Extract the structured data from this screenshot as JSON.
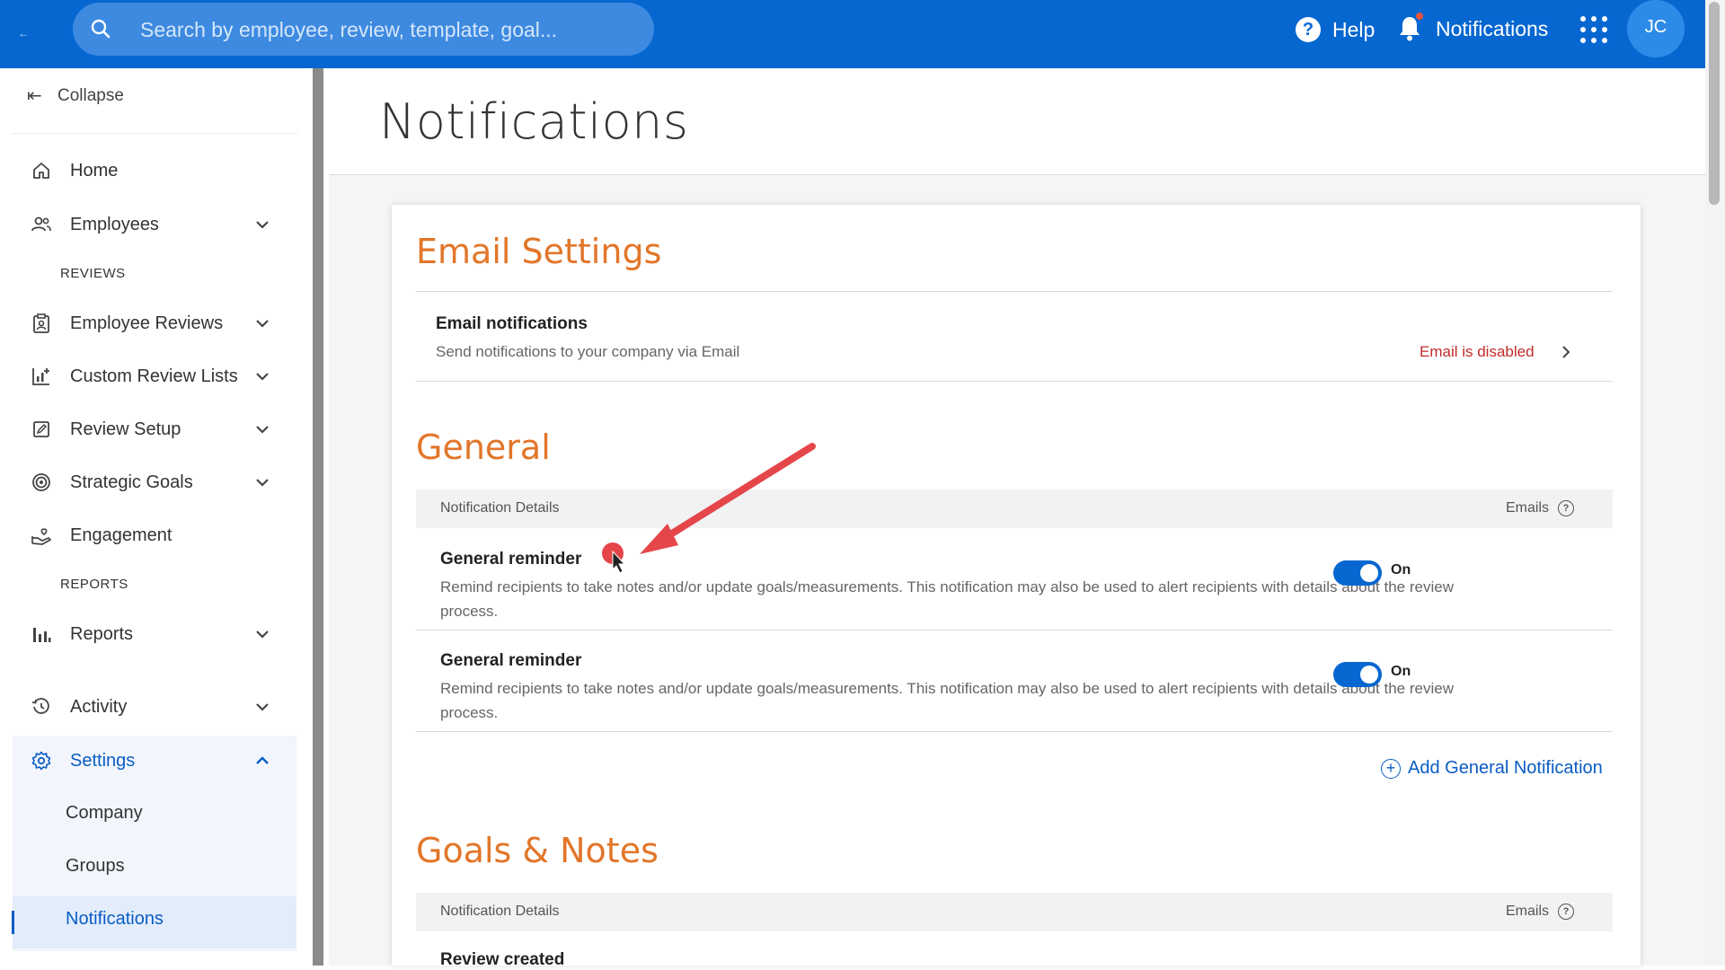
{
  "topbar": {
    "search_placeholder": "Search by employee, review, template, goal...",
    "help_label": "Help",
    "notifications_label": "Notifications",
    "avatar_initials": "JC"
  },
  "sidebar": {
    "collapse_label": "Collapse",
    "items": [
      {
        "label": "Home"
      },
      {
        "label": "Employees"
      },
      {
        "label": "Employee Reviews"
      },
      {
        "label": "Custom Review Lists"
      },
      {
        "label": "Review Setup"
      },
      {
        "label": "Strategic Goals"
      },
      {
        "label": "Engagement"
      },
      {
        "label": "Reports"
      },
      {
        "label": "Activity"
      },
      {
        "label": "Settings"
      }
    ],
    "sections": {
      "reviews": "REVIEWS",
      "reports": "REPORTS"
    },
    "settings_sub": [
      "Company",
      "Groups",
      "Notifications"
    ]
  },
  "main": {
    "page_title": "Notifications",
    "email_settings": {
      "title": "Email Settings",
      "row_title": "Email notifications",
      "row_desc": "Send notifications to your company via Email",
      "status": "Email is disabled"
    },
    "general": {
      "title": "General",
      "col_details": "Notification Details",
      "col_emails": "Emails",
      "rows": [
        {
          "title": "General reminder",
          "desc": "Remind recipients to take notes and/or update goals/measurements. This notification may also be used to alert recipients with details about the review process.",
          "toggle": "On"
        },
        {
          "title": "General reminder",
          "desc": "Remind recipients to take notes and/or update goals/measurements. This notification may also be used to alert recipients with details about the review process.",
          "toggle": "On"
        }
      ],
      "add_label": "Add General Notification"
    },
    "goals_notes": {
      "title": "Goals & Notes",
      "col_details": "Notification Details",
      "col_emails": "Emails",
      "first_row_title": "Review created"
    }
  },
  "colors": {
    "brand_blue": "#0667d1",
    "accent_orange": "#e2762a",
    "error_red": "#c22a2a",
    "annotation_red": "#e5464a"
  }
}
